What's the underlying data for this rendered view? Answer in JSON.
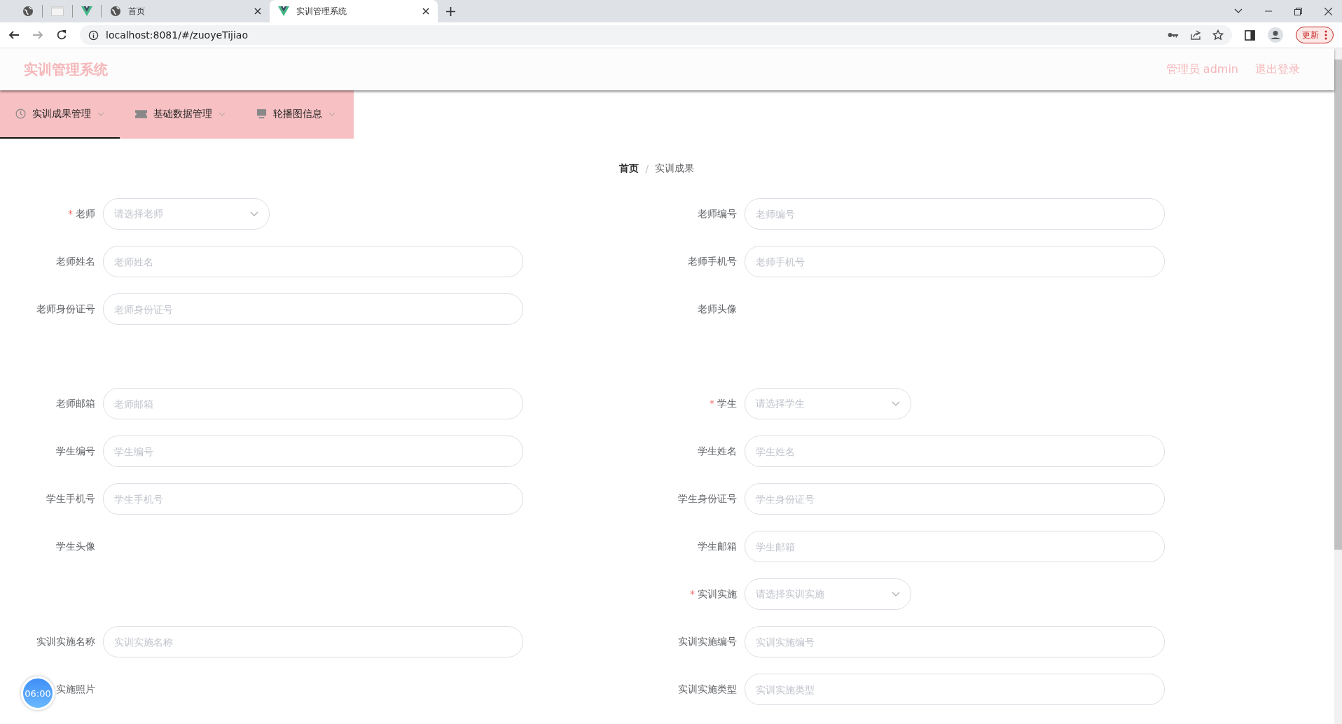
{
  "browser": {
    "tabs": [
      {
        "label": "首页",
        "selected": false
      },
      {
        "label": "实训管理系统",
        "selected": true
      }
    ],
    "url": "localhost:8081/#/zuoyeTijiao",
    "update_button": "更新"
  },
  "header": {
    "title": "实训管理系统",
    "user": "管理员 admin",
    "logout": "退出登录"
  },
  "nav": [
    {
      "label": "实训成果管理",
      "selected": true
    },
    {
      "label": "基础数据管理",
      "selected": false
    },
    {
      "label": "轮播图信息",
      "selected": false
    }
  ],
  "breadcrumb": [
    {
      "label": "首页",
      "current": false
    },
    {
      "separator": "/",
      "label": "实训成果",
      "current": true
    }
  ],
  "form_rows": [
    {
      "left": {
        "label": "老师",
        "kind": "select",
        "required_mark": "*",
        "placeholder": "请选择老师"
      },
      "right": {
        "label": "老师编号",
        "kind": "input",
        "placeholder": "老师编号"
      }
    },
    {
      "left": {
        "label": "老师姓名",
        "kind": "input",
        "placeholder": "老师姓名"
      },
      "right": {
        "label": "老师手机号",
        "kind": "input",
        "placeholder": "老师手机号"
      }
    },
    {
      "left": {
        "label": "老师身份证号",
        "kind": "input",
        "placeholder": "老师身份证号"
      },
      "right": {
        "label": "老师头像",
        "kind": "image"
      }
    },
    {
      "left": {
        "label": "老师邮箱",
        "kind": "input",
        "placeholder": "老师邮箱"
      },
      "right": {
        "label": "学生",
        "kind": "select",
        "required_mark": "*",
        "placeholder": "请选择学生"
      }
    },
    {
      "left": {
        "label": "学生编号",
        "kind": "input",
        "placeholder": "学生编号"
      },
      "right": {
        "label": "学生姓名",
        "kind": "input",
        "placeholder": "学生姓名"
      }
    },
    {
      "left": {
        "label": "学生手机号",
        "kind": "input",
        "placeholder": "学生手机号"
      },
      "right": {
        "label": "学生身份证号",
        "kind": "input",
        "placeholder": "学生身份证号"
      }
    },
    {
      "left": {
        "label": "学生头像",
        "kind": "image"
      },
      "right": {
        "label": "学生邮箱",
        "kind": "input",
        "placeholder": "学生邮箱"
      }
    },
    {
      "right": {
        "label": "实训实施",
        "kind": "select",
        "required_mark": "*",
        "placeholder": "请选择实训实施"
      }
    },
    {
      "left": {
        "label": "实训实施名称",
        "kind": "input",
        "placeholder": "实训实施名称"
      },
      "right": {
        "label": "实训实施编号",
        "kind": "input",
        "placeholder": "实训实施编号"
      }
    },
    {
      "left": {
        "label": "实施照片",
        "kind": "image"
      },
      "right": {
        "label": "实训实施类型",
        "kind": "input",
        "placeholder": "实训实施类型"
      }
    }
  ],
  "timer_badge": "06:00"
}
